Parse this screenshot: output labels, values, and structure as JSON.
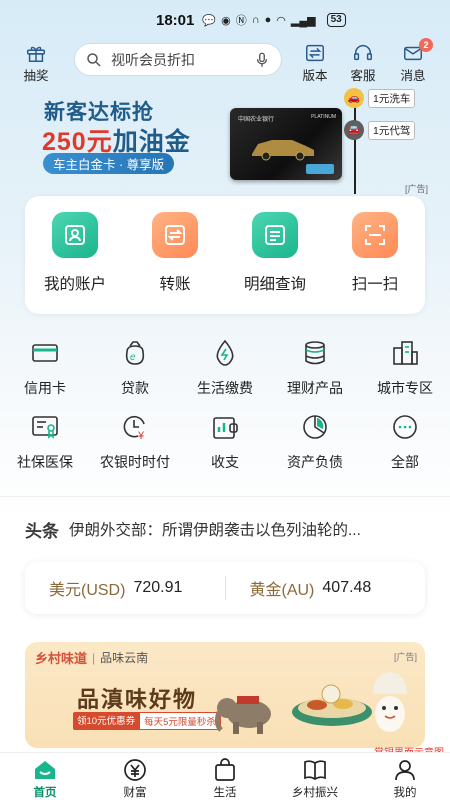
{
  "status_bar": {
    "time": "18:01",
    "battery": "53"
  },
  "header": {
    "lottery_label": "抽奖",
    "search_placeholder": "视听会员折扣",
    "version_label": "版本",
    "service_label": "客服",
    "message_label": "消息",
    "message_badge": "2"
  },
  "banner": {
    "line1": "新客达标抢",
    "amount": "250元",
    "amount_suffix": "加油金",
    "pill": "车主白金卡 · 尊享版",
    "card_bank": "中国农业银行",
    "card_tier": "PLATINUM",
    "gift1": "1元洗车",
    "gift2": "1元代驾",
    "ad_tag": "[广告]"
  },
  "quick_actions": [
    {
      "label": "我的账户",
      "icon": "account-icon",
      "color": "green"
    },
    {
      "label": "转账",
      "icon": "transfer-icon",
      "color": "orange"
    },
    {
      "label": "明细查询",
      "icon": "details-icon",
      "color": "green"
    },
    {
      "label": "扫一扫",
      "icon": "scan-icon",
      "color": "orange"
    }
  ],
  "services": [
    {
      "label": "信用卡",
      "icon": "credit-card-icon"
    },
    {
      "label": "贷款",
      "icon": "loan-icon"
    },
    {
      "label": "生活缴费",
      "icon": "utility-icon"
    },
    {
      "label": "理财产品",
      "icon": "wealth-icon"
    },
    {
      "label": "城市专区",
      "icon": "city-icon"
    },
    {
      "label": "社保医保",
      "icon": "social-insurance-icon"
    },
    {
      "label": "农银时时付",
      "icon": "clock-pay-icon"
    },
    {
      "label": "收支",
      "icon": "income-expense-icon"
    },
    {
      "label": "资产负债",
      "icon": "assets-icon"
    },
    {
      "label": "全部",
      "icon": "more-icon"
    }
  ],
  "news": {
    "tag": "头条",
    "text": "伊朗外交部：所谓伊朗袭击以色列油轮的..."
  },
  "rates": [
    {
      "name": "美元(USD)",
      "value": "720.91"
    },
    {
      "name": "黄金(AU)",
      "value": "407.48"
    }
  ],
  "promo": {
    "brand": "乡村味道",
    "sub": "品味云南",
    "headline": "品滇味好物",
    "coupon1": "领10元优惠券",
    "coupon2": "每天5元限量秒杀",
    "ad_tag": "[广告]"
  },
  "watermark": "掌银界面示意图",
  "tabs": [
    {
      "label": "首页",
      "active": true
    },
    {
      "label": "财富"
    },
    {
      "label": "生活"
    },
    {
      "label": "乡村振兴"
    },
    {
      "label": "我的"
    }
  ],
  "colors": {
    "accent_green": "#19b58c",
    "accent_orange": "#ff8a55",
    "brand_red": "#e0392b"
  }
}
